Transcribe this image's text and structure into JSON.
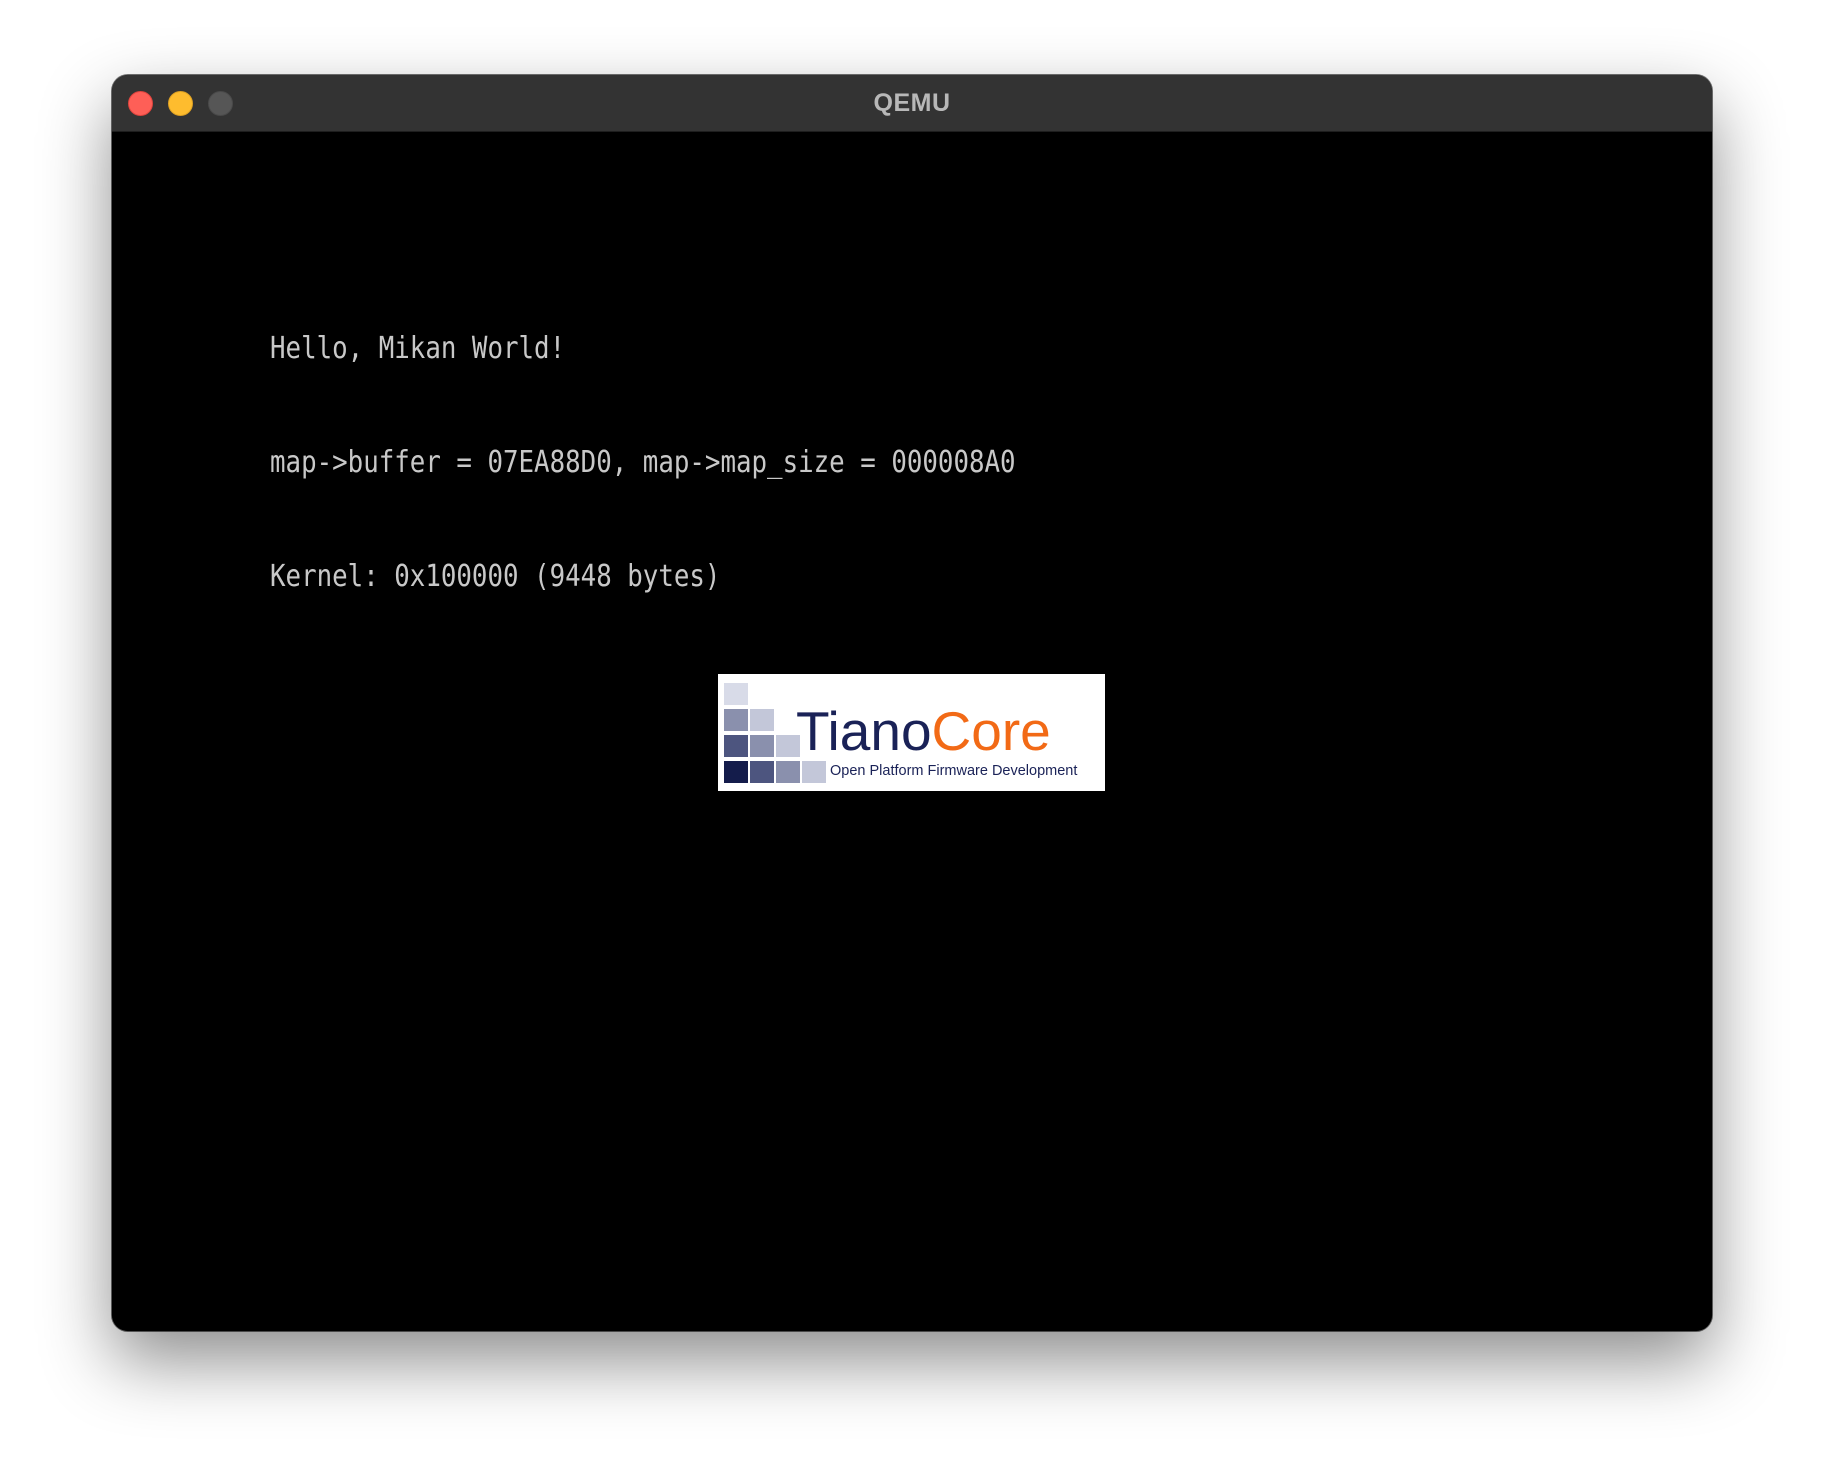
{
  "window": {
    "title": "QEMU",
    "controls": {
      "close": "close-button",
      "minimize": "minimize-button",
      "zoom": "zoom-button"
    }
  },
  "console": {
    "lines": [
      "Hello, Mikan World!",
      "map->buffer = 07EA88D0, map->map_size = 000008A0",
      "Kernel: 0x100000 (9448 bytes)"
    ]
  },
  "boot_logo": {
    "brand_primary": "Tiano",
    "brand_secondary": "Core",
    "tagline": "Open Platform Firmware Development",
    "colors": {
      "primary": "#1a2257",
      "secondary": "#f26a16"
    }
  },
  "colors": {
    "titlebar": "#333333",
    "screen_background": "#000000",
    "console_text": "#c8c8c8",
    "close": "#fe5f57",
    "minimize": "#febc2e",
    "zoom_disabled": "#565656"
  }
}
